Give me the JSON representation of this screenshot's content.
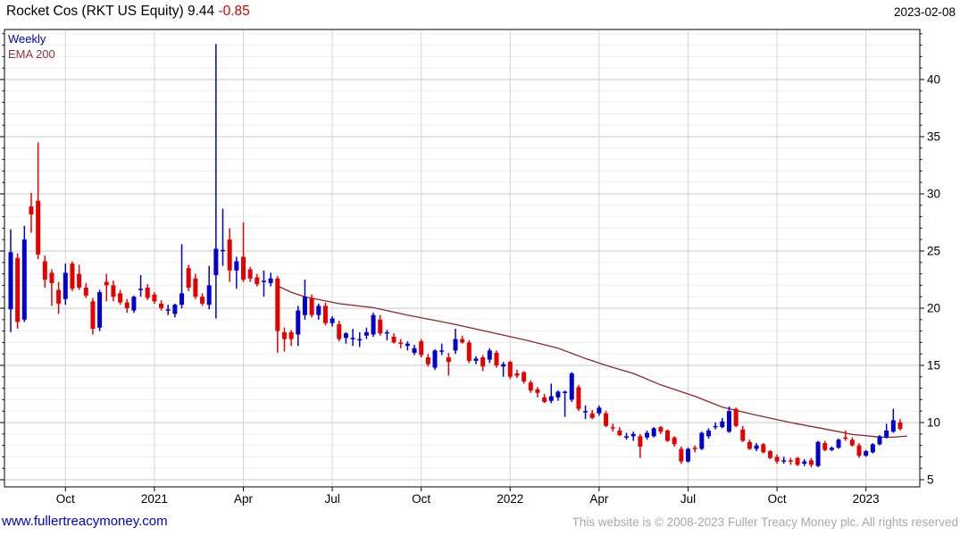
{
  "header": {
    "title": "Rocket Cos (RKT US Equity) 9.44 ",
    "change": "-0.85",
    "date": "2023-02-08"
  },
  "legend": {
    "timeframe": "Weekly",
    "overlay": "EMA 200"
  },
  "footer": {
    "site": "www.fullertreacymoney.com",
    "copyright": "This website is © 2008-2023 Fuller Treacy Money plc. All rights reserved"
  },
  "colors": {
    "up": "#0000d0",
    "down": "#e60000",
    "ema": "#8b2a2a",
    "grid_major": "#c8c8c8",
    "grid_minor": "#ededed",
    "grid_vertical": "#d4d4d4",
    "axis": "#000000",
    "tick_label": "#000000"
  },
  "chart_data": {
    "type": "candlestick",
    "interval": "Weekly",
    "instrument": "Rocket Cos (RKT US Equity)",
    "last_price": 9.44,
    "change": -0.85,
    "as_of": "2023-02-08",
    "overlay": "EMA 200",
    "ylim": [
      4.375,
      44.375
    ],
    "y_major_ticks": [
      5,
      10,
      15,
      20,
      25,
      30,
      35,
      40
    ],
    "y_minor_step": 1,
    "x_ticks": [
      {
        "week": 8,
        "label": "Oct"
      },
      {
        "week": 21,
        "label": "2021"
      },
      {
        "week": 34,
        "label": "Apr"
      },
      {
        "week": 47,
        "label": "Jul"
      },
      {
        "week": 60,
        "label": "Oct"
      },
      {
        "week": 73,
        "label": "2022"
      },
      {
        "week": 86,
        "label": "Apr"
      },
      {
        "week": 99,
        "label": "Jul"
      },
      {
        "week": 112,
        "label": "Oct"
      },
      {
        "week": 125,
        "label": "2023"
      }
    ],
    "candles": [
      [
        19.9,
        26.9,
        17.9,
        24.9
      ],
      [
        24.4,
        24.8,
        18.2,
        18.8
      ],
      [
        19.0,
        27.2,
        18.8,
        26.0
      ],
      [
        28.9,
        30.1,
        26.6,
        28.2
      ],
      [
        29.4,
        34.5,
        24.3,
        24.7
      ],
      [
        24.1,
        24.6,
        21.8,
        22.5
      ],
      [
        23.1,
        23.4,
        20.2,
        22.2
      ],
      [
        21.6,
        22.3,
        19.5,
        20.4
      ],
      [
        20.8,
        23.9,
        20.3,
        23.1
      ],
      [
        23.9,
        24.1,
        21.5,
        21.7
      ],
      [
        23.0,
        23.8,
        21.6,
        21.8
      ],
      [
        21.8,
        22.2,
        20.9,
        21.1
      ],
      [
        20.6,
        20.9,
        17.7,
        18.2
      ],
      [
        18.3,
        21.6,
        18.0,
        21.4
      ],
      [
        22.3,
        23.0,
        20.6,
        22.0
      ],
      [
        22.0,
        22.4,
        20.6,
        21.0
      ],
      [
        21.3,
        21.6,
        20.3,
        20.5
      ],
      [
        20.5,
        20.8,
        19.6,
        20.0
      ],
      [
        19.8,
        21.1,
        19.6,
        21.0
      ],
      [
        21.7,
        22.9,
        21.0,
        21.7
      ],
      [
        21.8,
        22.1,
        20.7,
        20.9
      ],
      [
        21.2,
        21.4,
        20.4,
        20.6
      ],
      [
        20.4,
        20.7,
        19.8,
        20.0
      ],
      [
        19.9,
        20.3,
        19.4,
        19.9
      ],
      [
        19.5,
        20.4,
        19.2,
        20.3
      ],
      [
        20.3,
        25.6,
        20.0,
        21.3
      ],
      [
        23.5,
        23.8,
        21.5,
        21.8
      ],
      [
        22.6,
        23.0,
        20.8,
        21.0
      ],
      [
        21.0,
        21.3,
        20.2,
        20.4
      ],
      [
        20.3,
        23.7,
        19.9,
        22.0
      ],
      [
        22.9,
        43.1,
        19.1,
        25.2
      ],
      [
        25.0,
        28.7,
        23.7,
        25.1
      ],
      [
        26.0,
        27.0,
        22.3,
        23.3
      ],
      [
        23.3,
        24.5,
        21.7,
        24.1
      ],
      [
        24.5,
        27.5,
        22.3,
        22.5
      ],
      [
        23.4,
        23.6,
        22.3,
        22.6
      ],
      [
        22.7,
        23.0,
        21.9,
        22.1
      ],
      [
        22.3,
        23.3,
        21.0,
        22.4
      ],
      [
        22.2,
        23.1,
        21.9,
        22.6
      ],
      [
        22.6,
        22.8,
        16.1,
        18.0
      ],
      [
        17.9,
        18.3,
        16.2,
        17.3
      ],
      [
        17.9,
        18.1,
        16.7,
        17.3
      ],
      [
        17.7,
        20.2,
        16.7,
        19.8
      ],
      [
        19.4,
        22.5,
        19.0,
        21.0
      ],
      [
        20.9,
        21.2,
        19.2,
        19.4
      ],
      [
        19.4,
        20.4,
        19.0,
        20.2
      ],
      [
        20.2,
        20.5,
        18.5,
        18.7
      ],
      [
        18.7,
        19.3,
        18.4,
        19.1
      ],
      [
        18.6,
        18.9,
        17.1,
        17.3
      ],
      [
        17.4,
        17.9,
        16.9,
        17.8
      ],
      [
        17.3,
        18.2,
        16.7,
        17.4
      ],
      [
        17.3,
        17.9,
        16.6,
        17.3
      ],
      [
        17.6,
        18.3,
        17.3,
        17.9
      ],
      [
        17.7,
        19.6,
        17.5,
        19.4
      ],
      [
        19.0,
        19.4,
        17.6,
        17.8
      ],
      [
        17.8,
        18.1,
        17.2,
        17.9
      ],
      [
        17.5,
        17.8,
        16.9,
        17.0
      ],
      [
        17.0,
        17.3,
        16.5,
        16.9
      ],
      [
        16.7,
        17.1,
        16.3,
        16.9
      ],
      [
        16.1,
        16.8,
        15.9,
        16.5
      ],
      [
        17.1,
        17.3,
        15.7,
        15.9
      ],
      [
        15.7,
        16.0,
        14.9,
        15.1
      ],
      [
        14.8,
        16.4,
        14.6,
        16.3
      ],
      [
        16.2,
        16.9,
        15.9,
        16.3
      ],
      [
        15.7,
        16.1,
        14.1,
        15.3
      ],
      [
        16.3,
        18.2,
        16.0,
        17.3
      ],
      [
        17.3,
        17.6,
        16.9,
        17.0
      ],
      [
        17.0,
        17.2,
        15.2,
        15.4
      ],
      [
        15.4,
        15.8,
        15.1,
        15.6
      ],
      [
        15.7,
        15.9,
        14.5,
        14.9
      ],
      [
        15.5,
        16.5,
        15.2,
        16.3
      ],
      [
        16.1,
        16.3,
        14.8,
        15.0
      ],
      [
        14.9,
        15.3,
        14.0,
        15.1
      ],
      [
        15.3,
        15.4,
        13.8,
        14.0
      ],
      [
        14.3,
        14.6,
        13.9,
        14.1
      ],
      [
        14.4,
        14.5,
        13.4,
        13.6
      ],
      [
        13.5,
        13.7,
        12.6,
        12.8
      ],
      [
        12.9,
        13.1,
        12.2,
        12.6
      ],
      [
        12.2,
        12.5,
        11.7,
        11.8
      ],
      [
        11.9,
        13.4,
        11.7,
        12.3
      ],
      [
        12.2,
        12.8,
        11.9,
        12.7
      ],
      [
        12.6,
        12.8,
        10.5,
        12.7
      ],
      [
        12.0,
        14.4,
        11.8,
        14.3
      ],
      [
        13.1,
        13.3,
        11.0,
        11.2
      ],
      [
        10.9,
        11.5,
        10.3,
        11.0
      ],
      [
        10.8,
        11.1,
        10.3,
        10.4
      ],
      [
        10.8,
        11.5,
        10.6,
        11.3
      ],
      [
        10.8,
        11.0,
        9.6,
        9.7
      ],
      [
        9.6,
        9.9,
        9.2,
        9.5
      ],
      [
        9.3,
        9.6,
        8.8,
        8.9
      ],
      [
        8.8,
        9.1,
        8.5,
        8.8
      ],
      [
        8.8,
        9.2,
        8.4,
        9.0
      ],
      [
        8.8,
        9.0,
        6.9,
        7.9
      ],
      [
        8.7,
        9.3,
        8.5,
        9.1
      ],
      [
        8.8,
        9.6,
        8.7,
        9.5
      ],
      [
        9.6,
        9.7,
        9.0,
        9.2
      ],
      [
        9.3,
        9.4,
        8.3,
        8.4
      ],
      [
        8.7,
        8.8,
        7.9,
        8.1
      ],
      [
        7.7,
        7.9,
        6.4,
        6.6
      ],
      [
        6.6,
        7.8,
        6.5,
        7.7
      ],
      [
        7.8,
        8.0,
        7.4,
        7.7
      ],
      [
        7.7,
        9.2,
        7.6,
        9.1
      ],
      [
        8.8,
        9.5,
        8.6,
        9.3
      ],
      [
        9.6,
        10.0,
        9.4,
        9.7
      ],
      [
        9.6,
        10.4,
        9.5,
        10.1
      ],
      [
        9.2,
        11.4,
        9.1,
        11.0
      ],
      [
        11.2,
        11.3,
        9.6,
        9.7
      ],
      [
        9.4,
        9.7,
        8.3,
        8.4
      ],
      [
        8.3,
        8.5,
        7.6,
        7.7
      ],
      [
        7.7,
        8.2,
        7.5,
        8.0
      ],
      [
        8.1,
        8.2,
        7.3,
        7.4
      ],
      [
        7.5,
        7.6,
        6.8,
        6.9
      ],
      [
        7.0,
        7.2,
        6.4,
        6.6
      ],
      [
        6.7,
        7.0,
        6.4,
        6.7
      ],
      [
        6.7,
        6.9,
        6.3,
        6.6
      ],
      [
        6.9,
        7.0,
        6.2,
        6.3
      ],
      [
        6.4,
        6.8,
        6.2,
        6.6
      ],
      [
        6.7,
        6.9,
        6.1,
        6.3
      ],
      [
        6.2,
        8.4,
        6.1,
        8.3
      ],
      [
        8.2,
        8.4,
        7.5,
        7.6
      ],
      [
        7.6,
        7.9,
        7.5,
        7.8
      ],
      [
        7.8,
        8.6,
        7.7,
        8.5
      ],
      [
        8.7,
        9.3,
        8.4,
        8.6
      ],
      [
        8.5,
        8.7,
        7.9,
        8.0
      ],
      [
        8.0,
        8.2,
        6.9,
        7.1
      ],
      [
        7.1,
        7.6,
        7.0,
        7.5
      ],
      [
        7.4,
        8.2,
        7.3,
        8.1
      ],
      [
        8.1,
        8.9,
        8.0,
        8.8
      ],
      [
        8.7,
        9.9,
        8.6,
        9.3
      ],
      [
        9.2,
        11.2,
        9.1,
        10.2
      ],
      [
        10.0,
        10.3,
        9.3,
        9.44
      ]
    ],
    "ema200": [
      [
        39,
        21.95
      ],
      [
        41,
        21.4
      ],
      [
        43,
        21.0
      ],
      [
        48,
        20.4
      ],
      [
        53,
        20.05
      ],
      [
        58,
        19.4
      ],
      [
        64,
        18.7
      ],
      [
        69,
        18.05
      ],
      [
        75,
        17.25
      ],
      [
        80,
        16.5
      ],
      [
        84,
        15.6
      ],
      [
        87,
        15.0
      ],
      [
        91,
        14.3
      ],
      [
        95,
        13.3
      ],
      [
        100,
        12.3
      ],
      [
        104,
        11.35
      ],
      [
        109,
        10.65
      ],
      [
        114,
        10.0
      ],
      [
        118,
        9.55
      ],
      [
        121,
        9.2
      ],
      [
        123,
        8.95
      ],
      [
        125,
        8.85
      ],
      [
        127,
        8.73
      ],
      [
        129,
        8.72
      ],
      [
        131,
        8.82
      ]
    ]
  }
}
